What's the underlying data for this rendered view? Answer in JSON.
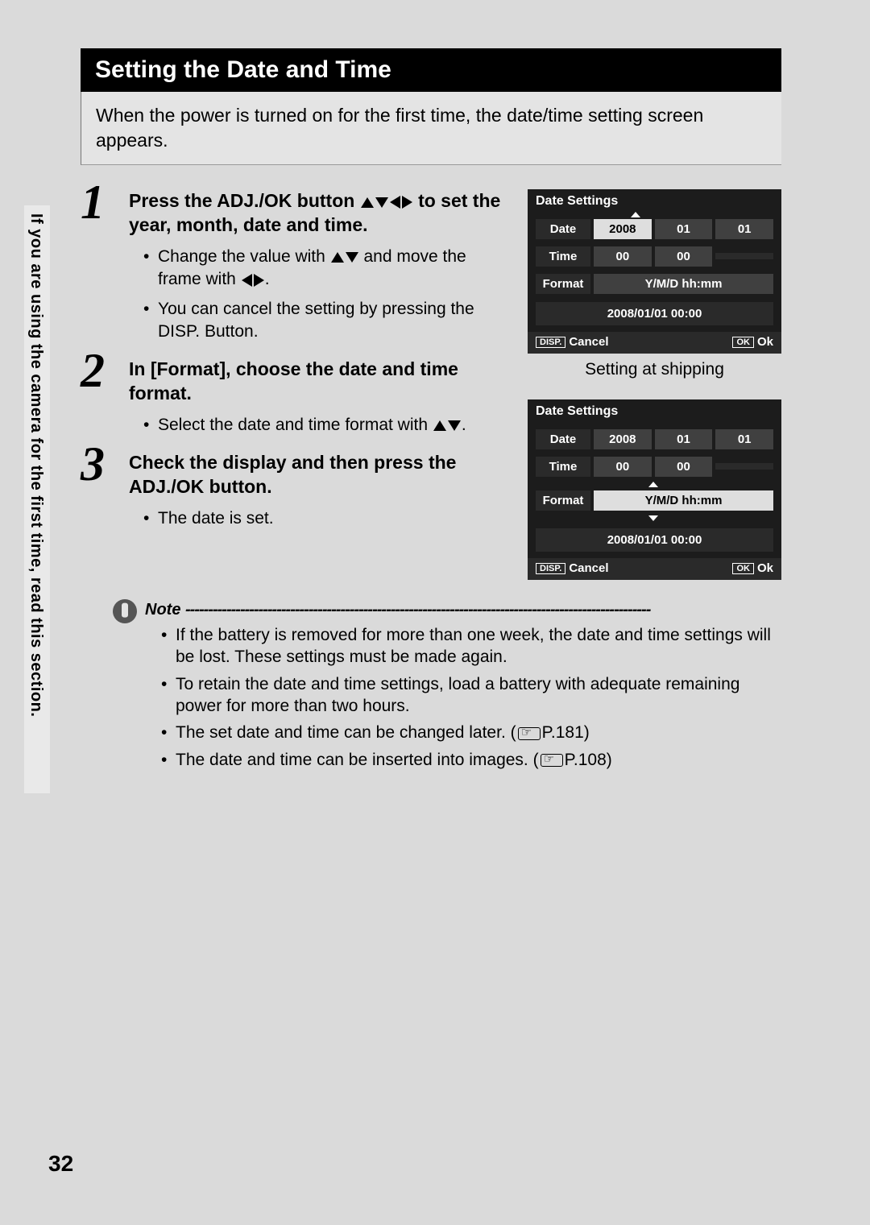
{
  "sidebar_text": "If you are using the camera for the first time, read this section.",
  "section_title": "Setting the Date and Time",
  "intro": "When the power is turned on for the first time, the date/time setting screen appears.",
  "steps": [
    {
      "num": "1",
      "head_a": "Press the ADJ./OK button ",
      "head_b": " to set the year, month, date and time.",
      "bullets_a1": "Change the value with ",
      "bullets_a2": " and move the frame with ",
      "bullets_a3": ".",
      "bullets_b": "You can cancel the setting by pressing the DISP. Button."
    },
    {
      "num": "2",
      "head": "In [Format], choose the date and time format.",
      "bullets_a1": "Select the date and time format with ",
      "bullets_a2": "."
    },
    {
      "num": "3",
      "head": "Check the display and then press the ADJ./OK button.",
      "bullets_a": "The date is set."
    }
  ],
  "screens": {
    "title": "Date Settings",
    "labels": {
      "date": "Date",
      "time": "Time",
      "format": "Format"
    },
    "values": {
      "year": "2008",
      "month": "01",
      "day": "01",
      "hh": "00",
      "mm": "00",
      "fmt": "Y/M/D hh:mm"
    },
    "preview": "2008/01/01  00:00",
    "foot": {
      "disp": "DISP.",
      "cancel": "Cancel",
      "ok_btn": "OK",
      "ok": "Ok"
    },
    "caption": "Setting at shipping"
  },
  "note": {
    "label": "Note",
    "items_plain": [
      "If the battery is removed for more than one week, the date and time settings will be lost. These settings must be made again.",
      "To retain the date and time settings, load a battery with adequate remaining power for more than two hours."
    ],
    "item3_a": "The set date and time can be changed later. (",
    "item3_b": "P.181)",
    "item4_a": "The date and time can be inserted into images. (",
    "item4_b": "P.108)"
  },
  "page_number": "32"
}
